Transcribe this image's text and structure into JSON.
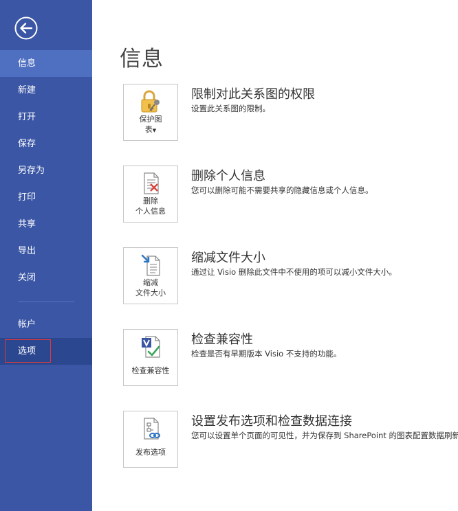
{
  "sidebar": {
    "items": [
      {
        "label": "信息"
      },
      {
        "label": "新建"
      },
      {
        "label": "打开"
      },
      {
        "label": "保存"
      },
      {
        "label": "另存为"
      },
      {
        "label": "打印"
      },
      {
        "label": "共享"
      },
      {
        "label": "导出"
      },
      {
        "label": "关闭"
      }
    ],
    "account_label": "帐户",
    "options_label": "选项"
  },
  "main": {
    "title": "信息",
    "sections": [
      {
        "icon": "lock-key-icon",
        "button_line1": "保护图",
        "button_line2": "表",
        "title": "限制对此关系图的权限",
        "description": "设置此关系图的限制。"
      },
      {
        "icon": "remove-personal-info-icon",
        "button_line1": "删除",
        "button_line2": "个人信息",
        "title": "删除个人信息",
        "description": "您可以删除可能不需要共享的隐藏信息或个人信息。"
      },
      {
        "icon": "reduce-file-size-icon",
        "button_line1": "缩减",
        "button_line2": "文件大小",
        "title": "缩减文件大小",
        "description": "通过让 Visio 删除此文件中不使用的项可以减小文件大小。"
      },
      {
        "icon": "check-compatibility-icon",
        "button_line1": "检查兼容性",
        "title": "检查兼容性",
        "description": "检查是否有早期版本 Visio 不支持的功能。"
      },
      {
        "icon": "publish-options-icon",
        "button_line1": "发布选项",
        "title": "设置发布选项和检查数据连接",
        "description": "您可以设置单个页面的可见性，并为保存到 SharePoint 的图表配置数据刷新。"
      }
    ]
  },
  "colors": {
    "sidebar_bg": "#3a56a5",
    "sidebar_active": "#4f6fc0",
    "options_highlight": "#2b4790",
    "options_outline": "#e0393a"
  }
}
